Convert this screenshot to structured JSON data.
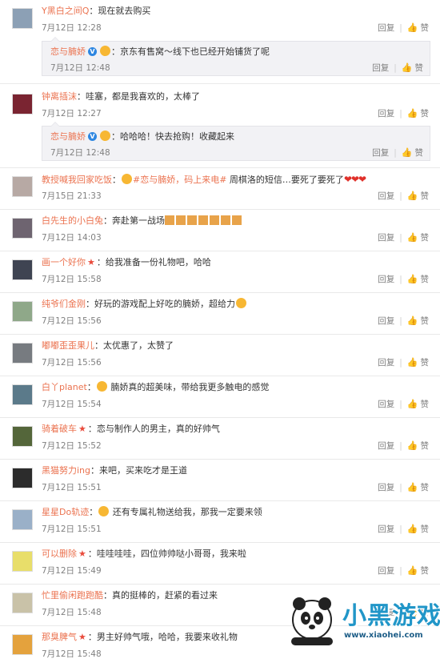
{
  "labels": {
    "reply": "回复",
    "like": "赞",
    "like_icon": "thumbs-up-icon",
    "sep": "|"
  },
  "colors": {
    "username": "#eb7350",
    "meta": "#808080",
    "reply_bg": "#f2f2f5",
    "verified": "#2d86e1"
  },
  "comments": [
    {
      "user": "Y黑白之间Q",
      "text": "：现在就去购买",
      "time": "7月12日 12:28",
      "reply": {
        "user": "恋与腩娇",
        "text": "：京东有售窝～线下也已经开始铺货了呢",
        "time": "7月12日 12:48"
      }
    },
    {
      "user": "钟离插沫",
      "text": "：哇塞，都是我喜欢的，太棒了",
      "time": "7月12日 12:27",
      "reply": {
        "user": "恋与腩娇",
        "text": "：哈哈哈！快去抢购！收藏起来",
        "time": "7月12日 12:48"
      }
    },
    {
      "user": "教授喊我回家吃饭",
      "text": "：",
      "hashtag": "#恋与腩娇，码上来电#",
      "text2": " 周棋洛的短信…要死了要死了",
      "hearts": "❤❤❤",
      "time": "7月15日 21:33"
    },
    {
      "user": "白先生的小白兔",
      "text": "：奔赴第一战场",
      "time": "7月12日 14:03"
    },
    {
      "user": "画一个好你",
      "text": "：给我准备一份礼物吧，哈哈",
      "time": "7月12日 15:58"
    },
    {
      "user": "纯爷们金刚",
      "text": "：好玩的游戏配上好吃的腩娇，超给力",
      "time": "7月12日 15:56"
    },
    {
      "user": "嘟嘟歪歪果儿",
      "text": "：太优惠了，太赞了",
      "time": "7月12日 15:56"
    },
    {
      "user": "白丫planet",
      "text": "：",
      "text2": " 腩娇真的超美味，带给我更多触电的感觉",
      "time": "7月12日 15:54"
    },
    {
      "user": "骑着破车",
      "text": "：恋与制作人的男主，真的好帅气",
      "time": "7月12日 15:52"
    },
    {
      "user": "黑猫努力ing",
      "text": "：来吧，买来吃才是王道",
      "time": "7月12日 15:51"
    },
    {
      "user": "星星Do轨迹",
      "text": "：",
      "text2": " 还有专属礼物送给我，那我一定要来领",
      "time": "7月12日 15:51"
    },
    {
      "user": "可以删除",
      "text": "：哇哇哇哇，四位帅帅哒小哥哥，我来啦",
      "time": "7月12日 15:49"
    },
    {
      "user": "忙里偷闲跑跑酷",
      "text": "：真的挺棒的，赶紧的看过来",
      "time": "7月12日 15:48"
    },
    {
      "user": "那臭脾气",
      "text": "：男主好帅气哦，哈哈，我要来收礼物",
      "time": "7月12日 15:48"
    }
  ],
  "watermark": {
    "brand": "小黑游戏",
    "url": "www.xiaohei.com",
    "logo_icon": "panda-icon"
  }
}
